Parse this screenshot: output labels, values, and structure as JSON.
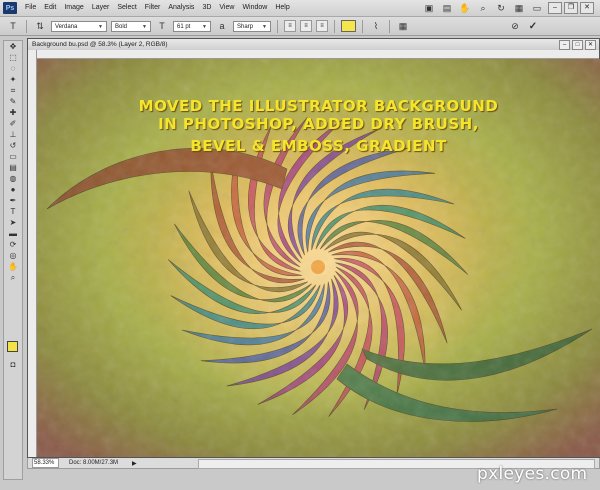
{
  "menubar": {
    "logo": "Ps",
    "items": [
      "File",
      "Edit",
      "Image",
      "Layer",
      "Select",
      "Filter",
      "Analysis",
      "3D",
      "View",
      "Window",
      "Help"
    ]
  },
  "options": {
    "tool_icon": "type-tool-icon",
    "font_family": "Verdana",
    "font_style": "Bold",
    "font_size": "61 pt",
    "antialias": "Sharp",
    "text_color": "#f6e64b"
  },
  "document": {
    "title": "Background bu.psd @ 58.3% (Layer 2, RGB/8)",
    "caption_lines": [
      "MOVED THE ILLUSTRATOR BACKGROUND",
      "IN PHOTOSHOP, ADDED DRY BRUSH,",
      "BEVEL & EMBOSS, GRADIENT"
    ]
  },
  "status": {
    "zoom": "58.33%",
    "doc_info": "Doc: 8.00M/27.3M"
  },
  "watermark": "pxleyes.com",
  "colors": {
    "caption": "#f4e52a",
    "foreground": "#f3e346",
    "background": "#ffffff"
  }
}
